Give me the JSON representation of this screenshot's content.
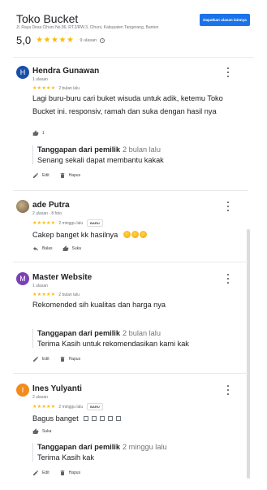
{
  "business": {
    "name": "Toko Bucket",
    "address": "Jl. Raya Desa Cihuni No.96, RT.2/RW.3, Cihuni, Kabupaten Tangerang, Banten",
    "cta_label": "Dapatkan ulasan lainnya",
    "rating": "5,0",
    "rating_stars": "★★★★★",
    "review_count": "9 ulasan",
    "info_glyph": "i"
  },
  "colors": {
    "star": "#fbbc04",
    "button": "#1a73e8",
    "avatar_hendra": "#1a4ea8",
    "avatar_master": "#7b3fb5",
    "avatar_ines": "#f08b1c"
  },
  "reviews": [
    {
      "initial": "H",
      "name": "Hendra Gunawan",
      "meta": "1 ulasan",
      "stars": "★★★★★",
      "time": "2 bulan lalu",
      "text": "Lagi buru-buru cari buket wisuda untuk adik, ketemu Toko Bucket ini. responsiv, ramah dan suka dengan hasil nya",
      "like_count": "1",
      "reply_owner": "Tanggapan dari pemilik",
      "reply_time": "2 bulan lalu",
      "reply_text": "Senang sekali dapat membantu kakak",
      "edit_label": "Edit",
      "delete_label": "Hapus"
    },
    {
      "initial": "",
      "name": "ade Putra",
      "meta": "2 ulasan · 8 foto",
      "stars": "★★★★★",
      "time": "2 minggu lalu",
      "badge": "BARU",
      "text": "Cakep banget kk hasilnya",
      "reply_label": "Balas",
      "like_label": "Suka"
    },
    {
      "initial": "M",
      "name": "Master Website",
      "meta": "1 ulasan",
      "stars": "★★★★★",
      "time": "2 bulan lalu",
      "text": "Rekomended sih kualitas dan harga nya",
      "reply_owner": "Tanggapan dari pemilik",
      "reply_time": "2 bulan lalu",
      "reply_text": "Terima Kasih untuk rekomendasikan kami kak",
      "edit_label": "Edit",
      "delete_label": "Hapus"
    },
    {
      "initial": "I",
      "name": "Ines Yulyanti",
      "meta": "2 ulasan",
      "stars": "★★★★★",
      "time": "2 minggu lalu",
      "badge": "BARU",
      "text": "Bagus banget",
      "like_label": "Suka",
      "reply_owner": "Tanggapan dari pemilik",
      "reply_time": "2 minggu lalu",
      "reply_text": "Terima Kasih kak",
      "edit_label": "Edit",
      "delete_label": "Hapus"
    }
  ]
}
